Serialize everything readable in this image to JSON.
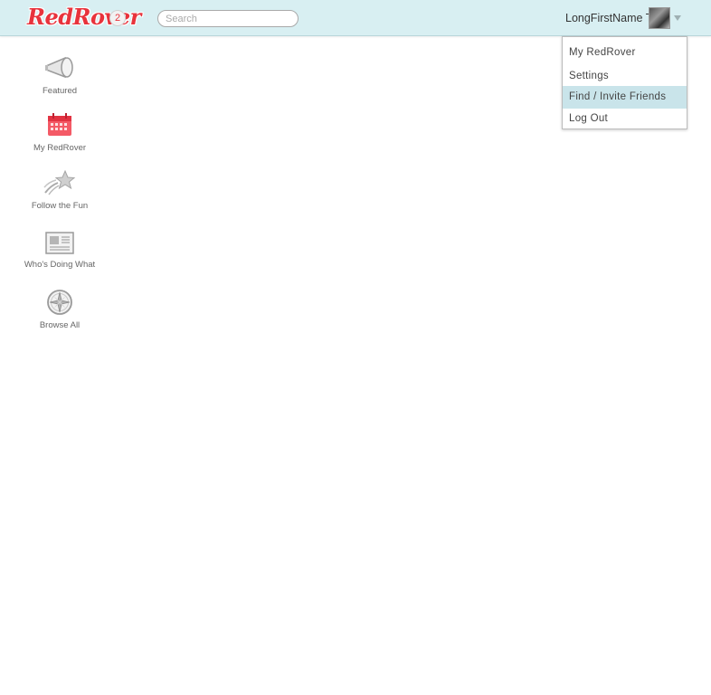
{
  "header": {
    "logo_text": "RedRover",
    "notification_count": "2",
    "search_placeholder": "Search",
    "user_name": "LongFirstName T.",
    "avatar_icon": "user-avatar",
    "menu_caret_icon": "caret-down-icon"
  },
  "user_menu": {
    "items": [
      {
        "label": "My RedRover",
        "active": false
      },
      {
        "label": "Settings",
        "active": false
      },
      {
        "label": "Find / Invite Friends",
        "active": true
      },
      {
        "label": "Log Out",
        "active": false
      }
    ]
  },
  "sidebar": {
    "items": [
      {
        "label": "Featured",
        "icon": "megaphone-icon"
      },
      {
        "label": "My RedRover",
        "icon": "calendar-icon"
      },
      {
        "label": "Follow the Fun",
        "icon": "shooting-star-icon"
      },
      {
        "label": "Who's Doing What",
        "icon": "newspaper-icon"
      },
      {
        "label": "Browse All",
        "icon": "compass-icon"
      }
    ]
  },
  "colors": {
    "brand_red": "#e8333c",
    "header_bg": "#d8eff2",
    "menu_highlight": "#c9e4ea"
  }
}
